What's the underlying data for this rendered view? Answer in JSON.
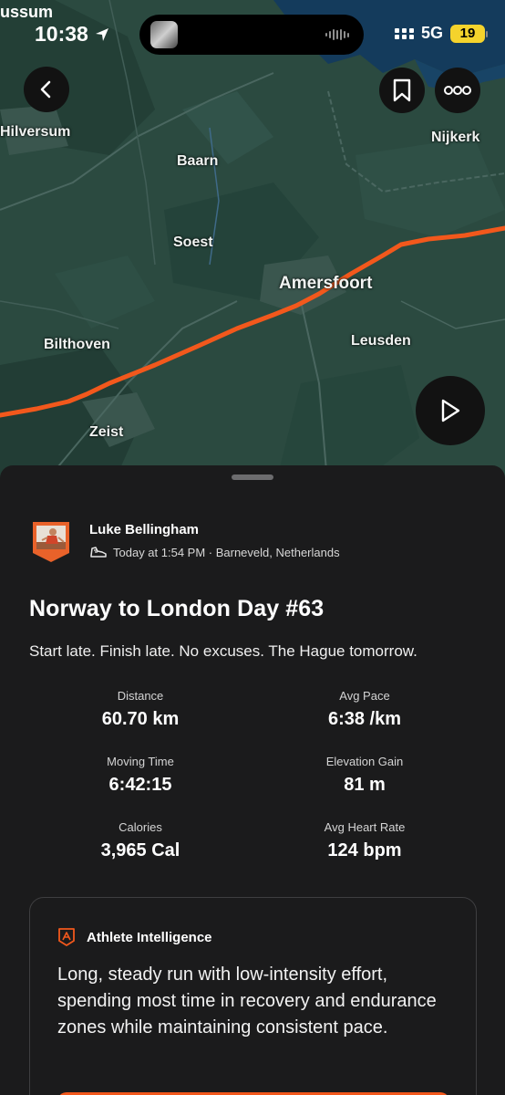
{
  "status_bar": {
    "carrier_left": "ussum",
    "time": "10:38",
    "network": "5G",
    "battery": "19"
  },
  "map": {
    "labels": {
      "hilversum": "Hilversum",
      "baarn": "Baarn",
      "nijkerk": "Nijkerk",
      "soest": "Soest",
      "amersfoort": "Amersfoort",
      "bilthoven": "Bilthoven",
      "leusden": "Leusden",
      "zeist": "Zeist"
    },
    "route_color": "#f2581c"
  },
  "icons": {
    "back": "chevron-left-icon",
    "bookmark": "bookmark-icon",
    "more": "more-dots-icon",
    "play": "play-icon",
    "shoe": "shoe-icon",
    "athlete_intelligence": "athlete-intelligence-icon"
  },
  "activity": {
    "athlete_name": "Luke Bellingham",
    "meta": "Today at 1:54 PM · Barneveld, Netherlands",
    "title": "Norway to London Day #63",
    "description": "Start late. Finish late. No excuses. The Hague tomorrow.",
    "stats": [
      {
        "label": "Distance",
        "value": "60.70 km"
      },
      {
        "label": "Avg Pace",
        "value": "6:38 /km"
      },
      {
        "label": "Moving Time",
        "value": "6:42:15"
      },
      {
        "label": "Elevation Gain",
        "value": "81 m"
      },
      {
        "label": "Calories",
        "value": "3,965 Cal"
      },
      {
        "label": "Avg Heart Rate",
        "value": "124 bpm"
      }
    ]
  },
  "athlete_intelligence": {
    "title": "Athlete Intelligence",
    "body": "Long, steady run with low-intensity effort, spending most time in recovery and endurance zones while maintaining consistent pace."
  },
  "colors": {
    "accent": "#f2581c",
    "sheet_bg": "#1b1b1c",
    "map_bg": "#2b4a40"
  }
}
